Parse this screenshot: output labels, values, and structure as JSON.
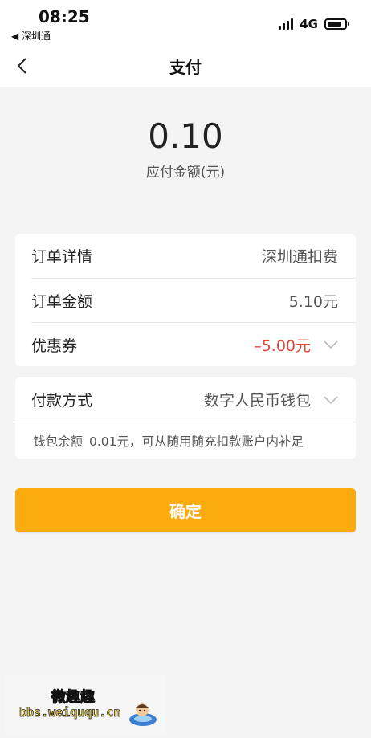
{
  "status_bar": {
    "time": "08:25",
    "back_app": "◀ 深圳通",
    "network": "4G",
    "battery_level": 0.85
  },
  "nav": {
    "back_icon": "chevron-left-icon",
    "title": "支付"
  },
  "amount": {
    "value": "0.10",
    "label": "应付金额(元)"
  },
  "order_card": {
    "rows": [
      {
        "label": "订单详情",
        "value": "深圳通扣费"
      },
      {
        "label": "订单金额",
        "value": "5.10元"
      },
      {
        "label": "优惠券",
        "value": "–5.00元",
        "value_color": "#e0443a",
        "icon": "chevron-down-icon"
      }
    ]
  },
  "payment_card": {
    "label": "付款方式",
    "value": "数字人民币钱包",
    "icon": "chevron-down-icon",
    "wallet_balance_label": "钱包余额",
    "wallet_balance_text": "0.01元，可从随用随充扣款账户内补足"
  },
  "confirm_button": {
    "label": "确定",
    "color": "#fcab0f"
  },
  "watermark": {
    "text_cn": "微趣趣",
    "url": "bbs.weiququ.cn"
  },
  "colors": {
    "background": "#f4f4f4",
    "accent": "#fcab0f",
    "discount": "#e0443a"
  }
}
